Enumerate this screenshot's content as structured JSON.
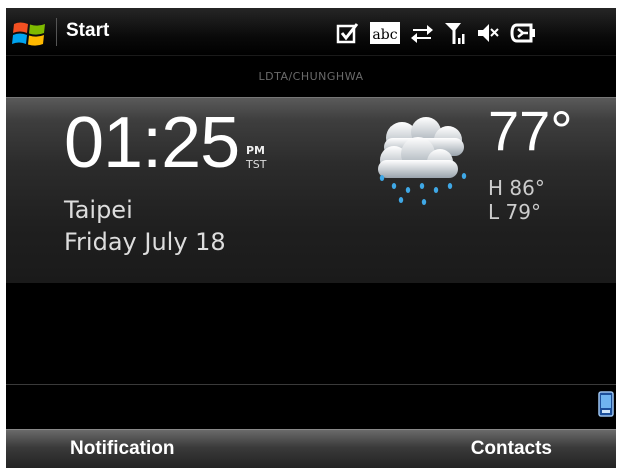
{
  "title_bar": {
    "start_label": "Start",
    "status_icons": [
      "checkbox-icon",
      "abc-input-icon",
      "data-transfer-icon",
      "signal-strength-icon",
      "speaker-muted-icon",
      "battery-icon"
    ],
    "abc_text": "abc"
  },
  "operator": "LDTA/CHUNGHWA",
  "clock": {
    "time": "01:25",
    "ampm": "PM",
    "timezone": "TST",
    "city": "Taipei",
    "date": "Friday July 18"
  },
  "weather": {
    "icon": "rain-cloud-icon",
    "temperature": "77°",
    "high": "H 86°",
    "low": "L 79°"
  },
  "softkeys": {
    "left": "Notification",
    "right": "Contacts"
  },
  "colors": {
    "background": "#000000",
    "windows_flag": [
      "#f25022",
      "#7fba00",
      "#00a4ef",
      "#ffb900"
    ]
  }
}
